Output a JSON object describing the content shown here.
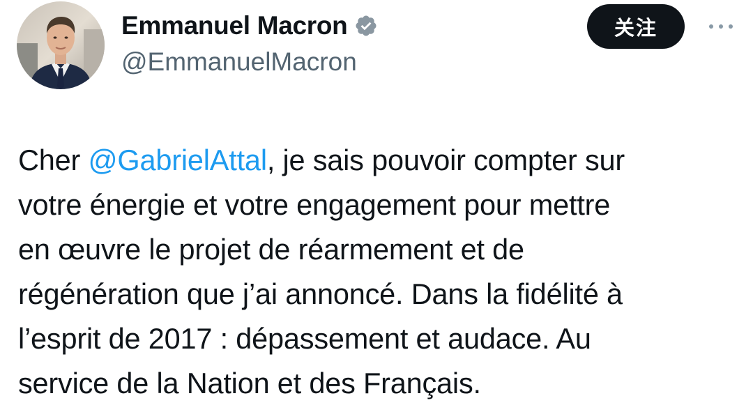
{
  "author": {
    "display_name": "Emmanuel Macron",
    "handle": "@EmmanuelMacron",
    "verified_icon": "verified-badge-icon",
    "avatar_icon": "avatar-photo"
  },
  "actions": {
    "follow_label": "关注",
    "more_icon": "more-options-icon"
  },
  "tweet": {
    "lines": [
      {
        "before": "Cher ",
        "mention": "@GabrielAttal",
        "after": ", je sais pouvoir compter sur"
      },
      {
        "text": "votre énergie et votre engagement pour mettre"
      },
      {
        "text": "en œuvre le projet de réarmement et de"
      },
      {
        "text": "régénération que j’ai annoncé. Dans la fidélité à"
      },
      {
        "text": "l’esprit de 2017 : dépassement et audace. Au"
      },
      {
        "text": "service de la Nation et des Français."
      }
    ]
  },
  "colors": {
    "text": "#0f1419",
    "secondary": "#536471",
    "link": "#1d9bf0",
    "button_bg": "#0f1419",
    "badge": "#8a97a1"
  }
}
